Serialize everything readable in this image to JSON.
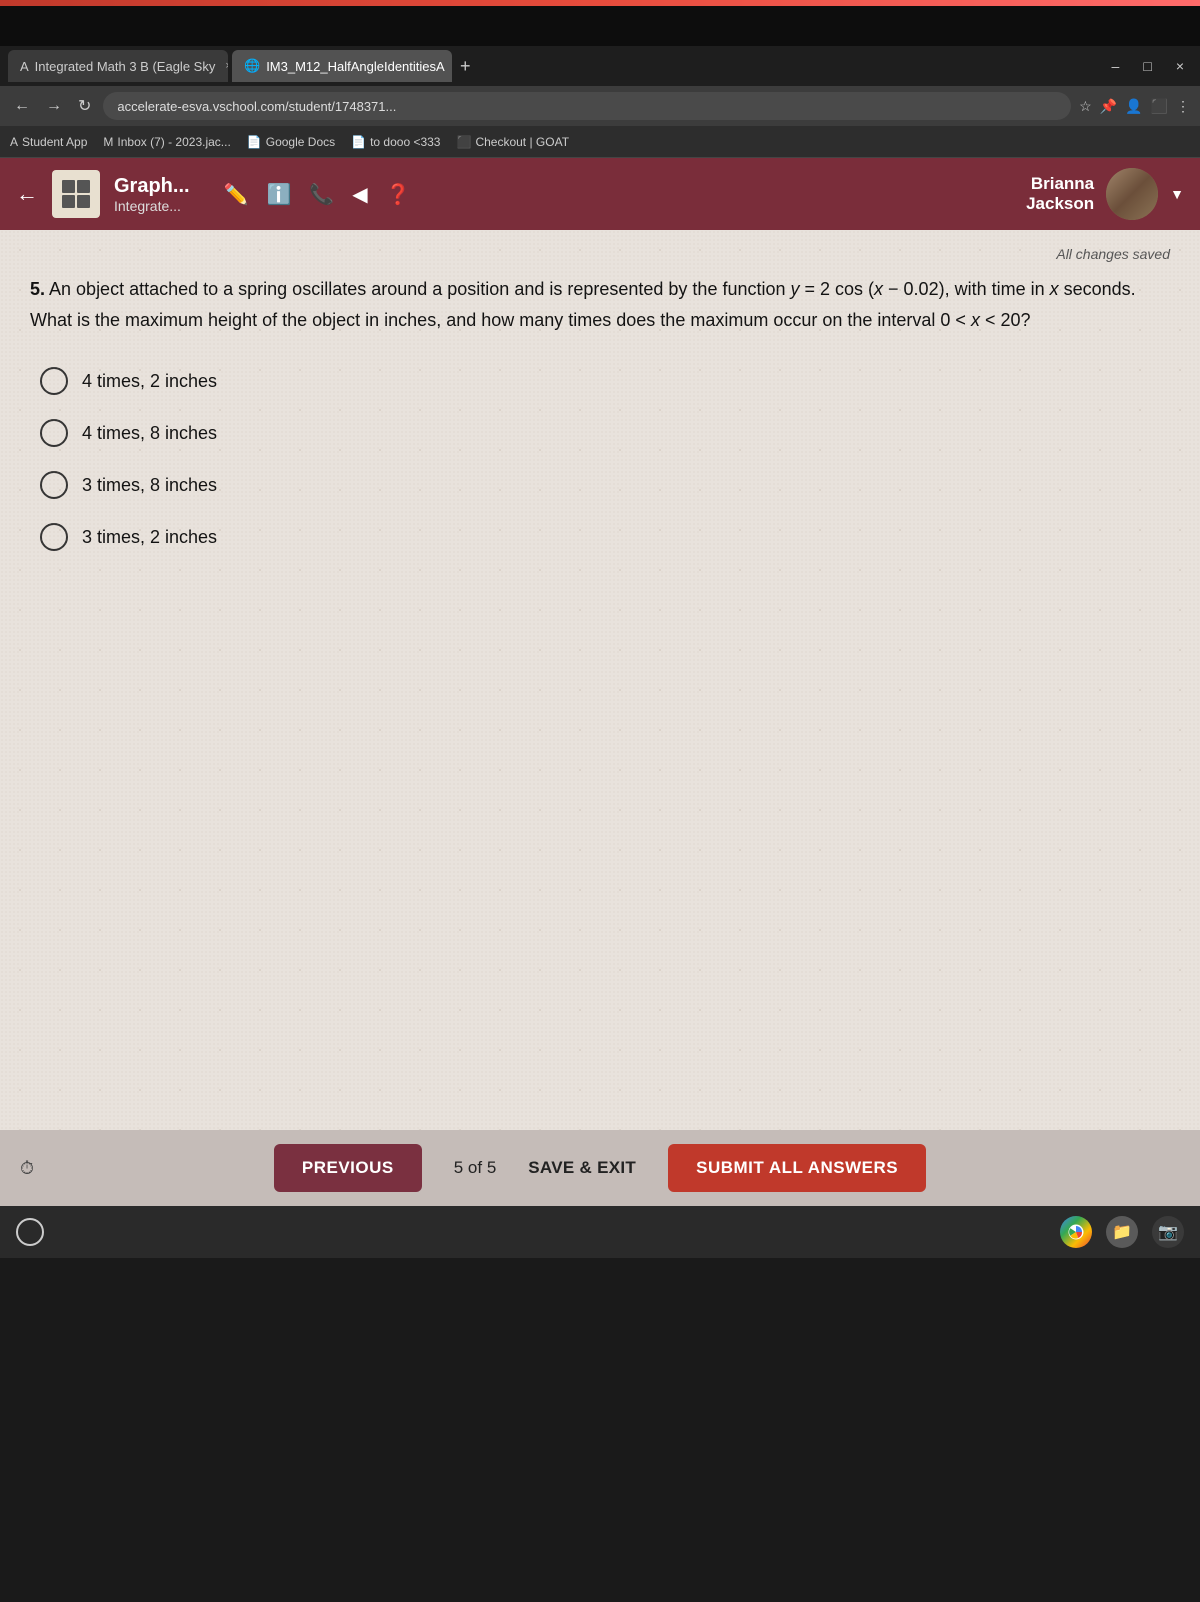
{
  "browser": {
    "tabs": [
      {
        "id": "tab1",
        "icon": "A",
        "label": "Integrated Math 3 B (Eagle Sky",
        "active": false
      },
      {
        "id": "tab2",
        "icon": "🌐",
        "label": "IM3_M12_HalfAngleIdentitiesA",
        "active": true
      }
    ],
    "address": "accelerate-esva.vschool.com/student/1748371...",
    "bookmarks": [
      {
        "label": "Student App"
      },
      {
        "label": "Inbox (7) - 2023.jac..."
      },
      {
        "label": "Google Docs"
      },
      {
        "label": "to dooo <333"
      },
      {
        "label": "Checkout | GOAT"
      }
    ],
    "window_controls": [
      "–",
      "□",
      "×"
    ]
  },
  "app": {
    "header": {
      "title": "Graph...",
      "subtitle": "Integrate...",
      "user_name": "Brianna\nJackson"
    },
    "saved_notice": "All changes saved",
    "question": {
      "number": "5.",
      "text": "An object attached to a spring oscillates around a position and is represented by the function y = 2 cos (x − 0.02), with time in x seconds. What is the maximum height of the object in inches, and how many times does the maximum occur on the interval 0 < x < 20?",
      "options": [
        {
          "id": "A",
          "label": "4 times, 2 inches"
        },
        {
          "id": "B",
          "label": "4 times, 8 inches"
        },
        {
          "id": "C",
          "label": "3 times, 8 inches"
        },
        {
          "id": "D",
          "label": "3 times, 2 inches"
        }
      ]
    },
    "bottom_bar": {
      "previous_label": "PREVIOUS",
      "page_indicator": "5 of 5",
      "save_exit_label": "SAVE & EXIT",
      "submit_label": "SUBMIT ALL ANSWERS"
    }
  }
}
